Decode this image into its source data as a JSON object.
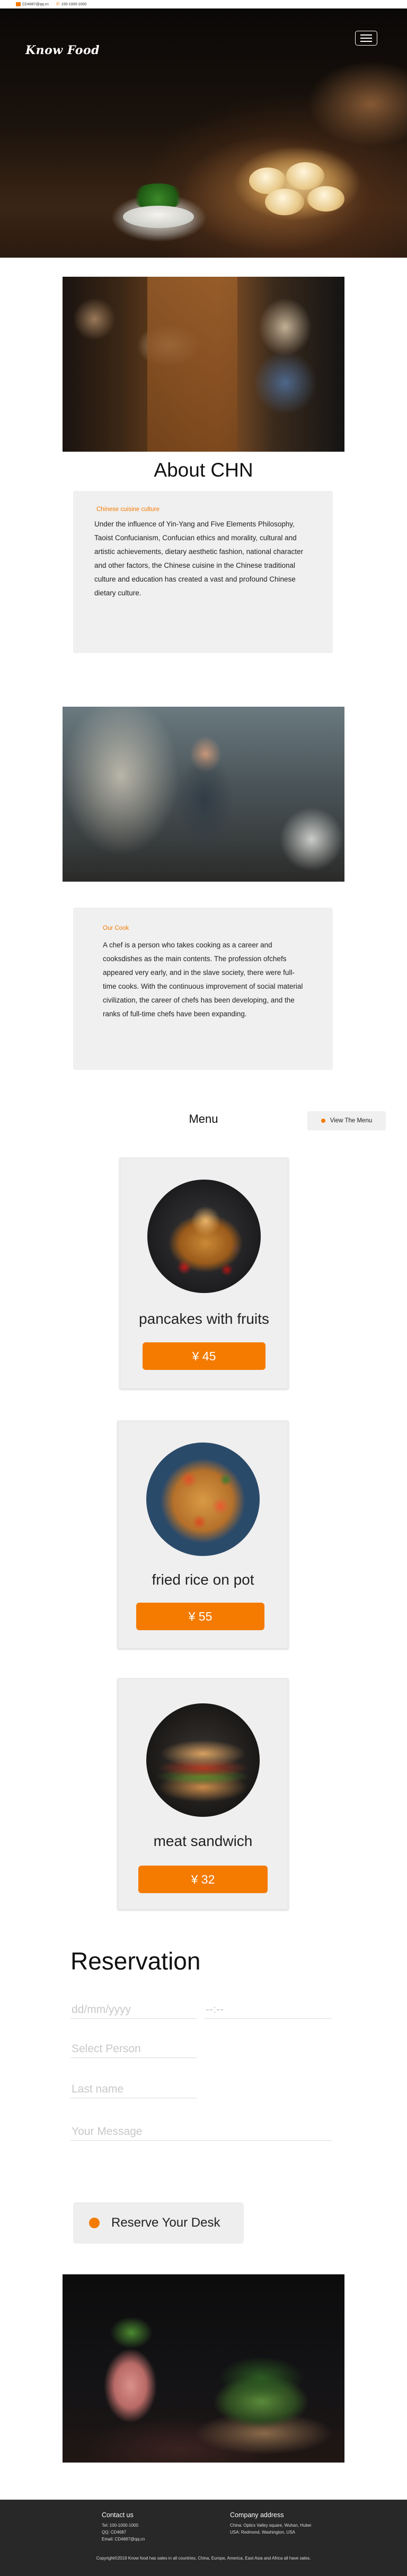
{
  "topbar": {
    "email": "CD4687@qq.cn",
    "phone": "100-1000-1000",
    "mail_icon": "envelope-icon",
    "phone_icon": "phone-icon"
  },
  "brand": {
    "logo_text": "Know Food"
  },
  "nav": {
    "menu_icon": "hamburger-icon"
  },
  "about": {
    "title": "About CHN",
    "label": "Chinese cuisine culture",
    "text": "Under the influence of Yin-Yang and Five Elements Philosophy, Taoist Confucianism, Confucian ethics and morality, cultural and artistic achievements, dietary aesthetic fashion, national character and other factors, the Chinese cuisine in the Chinese traditional culture and education has created a vast and profound Chinese dietary culture."
  },
  "cook": {
    "label": "Our Cook",
    "text": "A chef is a person who takes cooking as a career and cooksdishes as the main contents. The profession ofchefs appeared very early, and in the slave society, there were full-time cooks. With the continuous improvement of social material civilization, the career of chefs has been developing, and the ranks of full-time chefs have been expanding."
  },
  "menu": {
    "heading": "Menu",
    "view_button": "View The Menu",
    "items": [
      {
        "name": "pancakes with fruits",
        "price": "¥ 45"
      },
      {
        "name": "fried rice on pot",
        "price": "¥ 55"
      },
      {
        "name": "meat sandwich",
        "price": "¥ 32"
      }
    ]
  },
  "reservation": {
    "title": "Reservation",
    "date_placeholder": "dd/mm/yyyy",
    "time_placeholder": "--:--",
    "person_placeholder": "Select Person",
    "lastname_placeholder": "Last name",
    "message_placeholder": "Your Message",
    "button": "Reserve Your Desk"
  },
  "footer": {
    "contact_heading": "Contact us",
    "tel": "Tel: 100-1000-1000",
    "qq": "QQ: CD4687",
    "email": "Email: CD4687@qq.cn",
    "address_heading": "Company address",
    "address_1": "China: Optics Valley square, Wuhan, Hubei",
    "address_2": "USA: Redmond, Washington, USA",
    "copyright": "Copyright©2019 Know food has sales in all countries, China, Europe, America, East Asia and Africa all have sales."
  },
  "colors": {
    "accent": "#f47b00",
    "card_bg": "#f0f0f0",
    "footer_bg": "#282828"
  }
}
